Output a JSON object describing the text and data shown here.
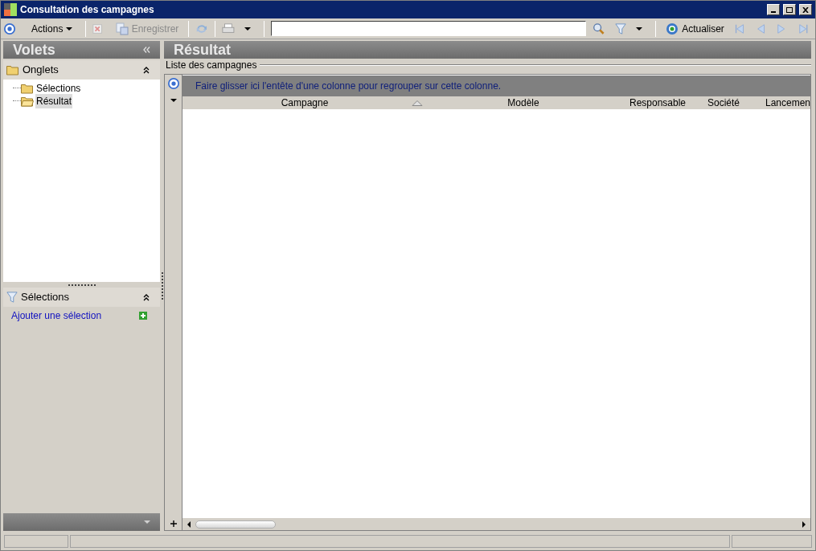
{
  "window": {
    "title": "Consultation des campagnes"
  },
  "toolbar": {
    "actions": "Actions",
    "save": {
      "label": "Enregistrer",
      "disabled": true
    },
    "refresh": "Actualiser"
  },
  "sidebar": {
    "title": "Volets",
    "tabs_title": "Onglets",
    "items": [
      {
        "label": "Sélections",
        "selected": false
      },
      {
        "label": "Résultat",
        "selected": true
      }
    ],
    "selections_title": "Sélections",
    "add_link": "Ajouter une sélection"
  },
  "main": {
    "title": "Résultat",
    "group_label": "Liste des campagnes",
    "group_hint": "Faire glisser ici l'entête d'une colonne pour regrouper sur cette colonne.",
    "columns": [
      {
        "label": "Campagne",
        "sorted": true
      },
      {
        "label": "Modèle",
        "sorted": false
      },
      {
        "label": "Responsable",
        "sorted": false
      },
      {
        "label": "Société",
        "sorted": false
      },
      {
        "label": "Lancemen",
        "sorted": false
      }
    ]
  }
}
